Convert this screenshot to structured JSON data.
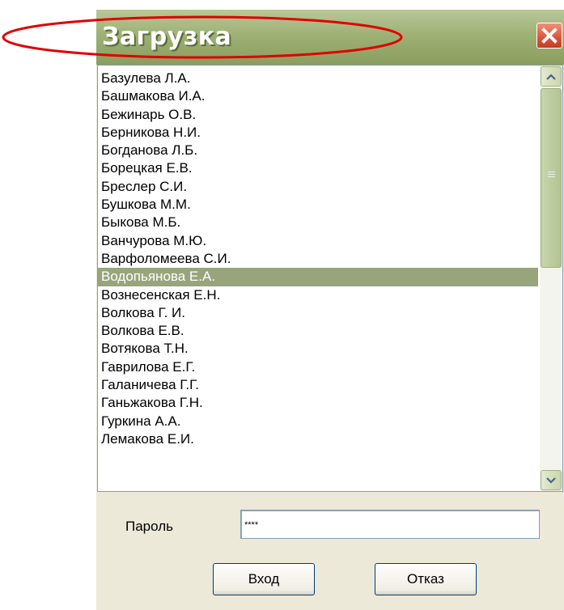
{
  "window": {
    "title": "Загрузка"
  },
  "list": {
    "items": [
      {
        "label": "Базулева Л.А."
      },
      {
        "label": "Башмакова И.А."
      },
      {
        "label": "Бежинарь О.В."
      },
      {
        "label": "Берникова Н.И."
      },
      {
        "label": "Богданова Л.Б."
      },
      {
        "label": "Борецкая Е.В."
      },
      {
        "label": "Бреслер С.И."
      },
      {
        "label": "Бушкова М.М."
      },
      {
        "label": "Быкова М.Б."
      },
      {
        "label": "Ванчурова М.Ю."
      },
      {
        "label": "Варфоломеева С.И."
      },
      {
        "label": "Водопьянова Е.А.",
        "selected": true
      },
      {
        "label": "Вознесенская Е.Н."
      },
      {
        "label": "Волкова Г. И."
      },
      {
        "label": "Волкова Е.В."
      },
      {
        "label": "Вотякова Т.Н."
      },
      {
        "label": "Гаврилова Е.Г."
      },
      {
        "label": "Галаничева Г.Г."
      },
      {
        "label": "Ганьжакова Г.Н."
      },
      {
        "label": "Гуркина А.А."
      },
      {
        "label": "Лемакова Е.И."
      }
    ]
  },
  "form": {
    "password_label": "Пароль",
    "password_value": "****",
    "login_label": "Вход",
    "cancel_label": "Отказ"
  },
  "colors": {
    "titlebar": "#9fb175",
    "selection": "#98a47c",
    "close_button": "#d9543a",
    "annotation": "#e00000"
  }
}
